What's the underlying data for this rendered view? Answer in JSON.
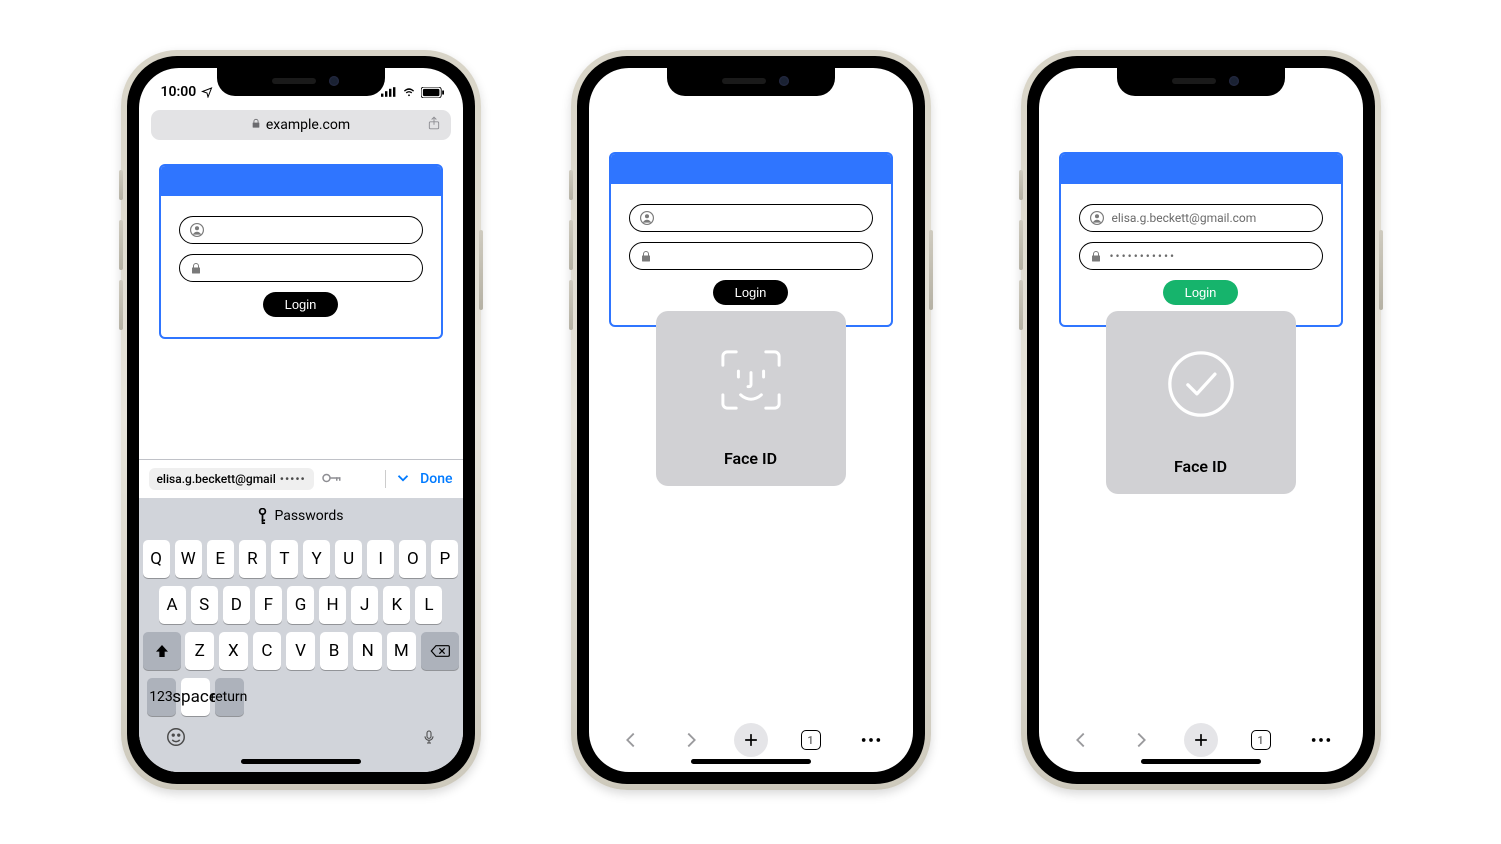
{
  "phone1": {
    "status_time": "10:00",
    "url_domain": "example.com",
    "login": {
      "username_value": "",
      "password_value": "",
      "button_label": "Login"
    },
    "autofill": {
      "suggestion_email": "elisa.g.beckett@gmail",
      "suggestion_dots": "•••••",
      "done_label": "Done",
      "passwords_label": "Passwords"
    },
    "keyboard": {
      "row1": [
        "Q",
        "W",
        "E",
        "R",
        "T",
        "Y",
        "U",
        "I",
        "O",
        "P"
      ],
      "row2": [
        "A",
        "S",
        "D",
        "F",
        "G",
        "H",
        "J",
        "K",
        "L"
      ],
      "row3": [
        "Z",
        "X",
        "C",
        "V",
        "B",
        "N",
        "M"
      ],
      "num_label": "123",
      "space_label": "space",
      "return_label": "return"
    }
  },
  "phone2": {
    "login": {
      "username_value": "",
      "password_value": "",
      "button_label": "Login"
    },
    "faceid_label": "Face ID",
    "tab_count": "1"
  },
  "phone3": {
    "login": {
      "username_value": "elisa.g.beckett@gmail.com",
      "password_value": "•••••••••••",
      "button_label": "Login"
    },
    "faceid_label": "Face ID",
    "tab_count": "1"
  }
}
